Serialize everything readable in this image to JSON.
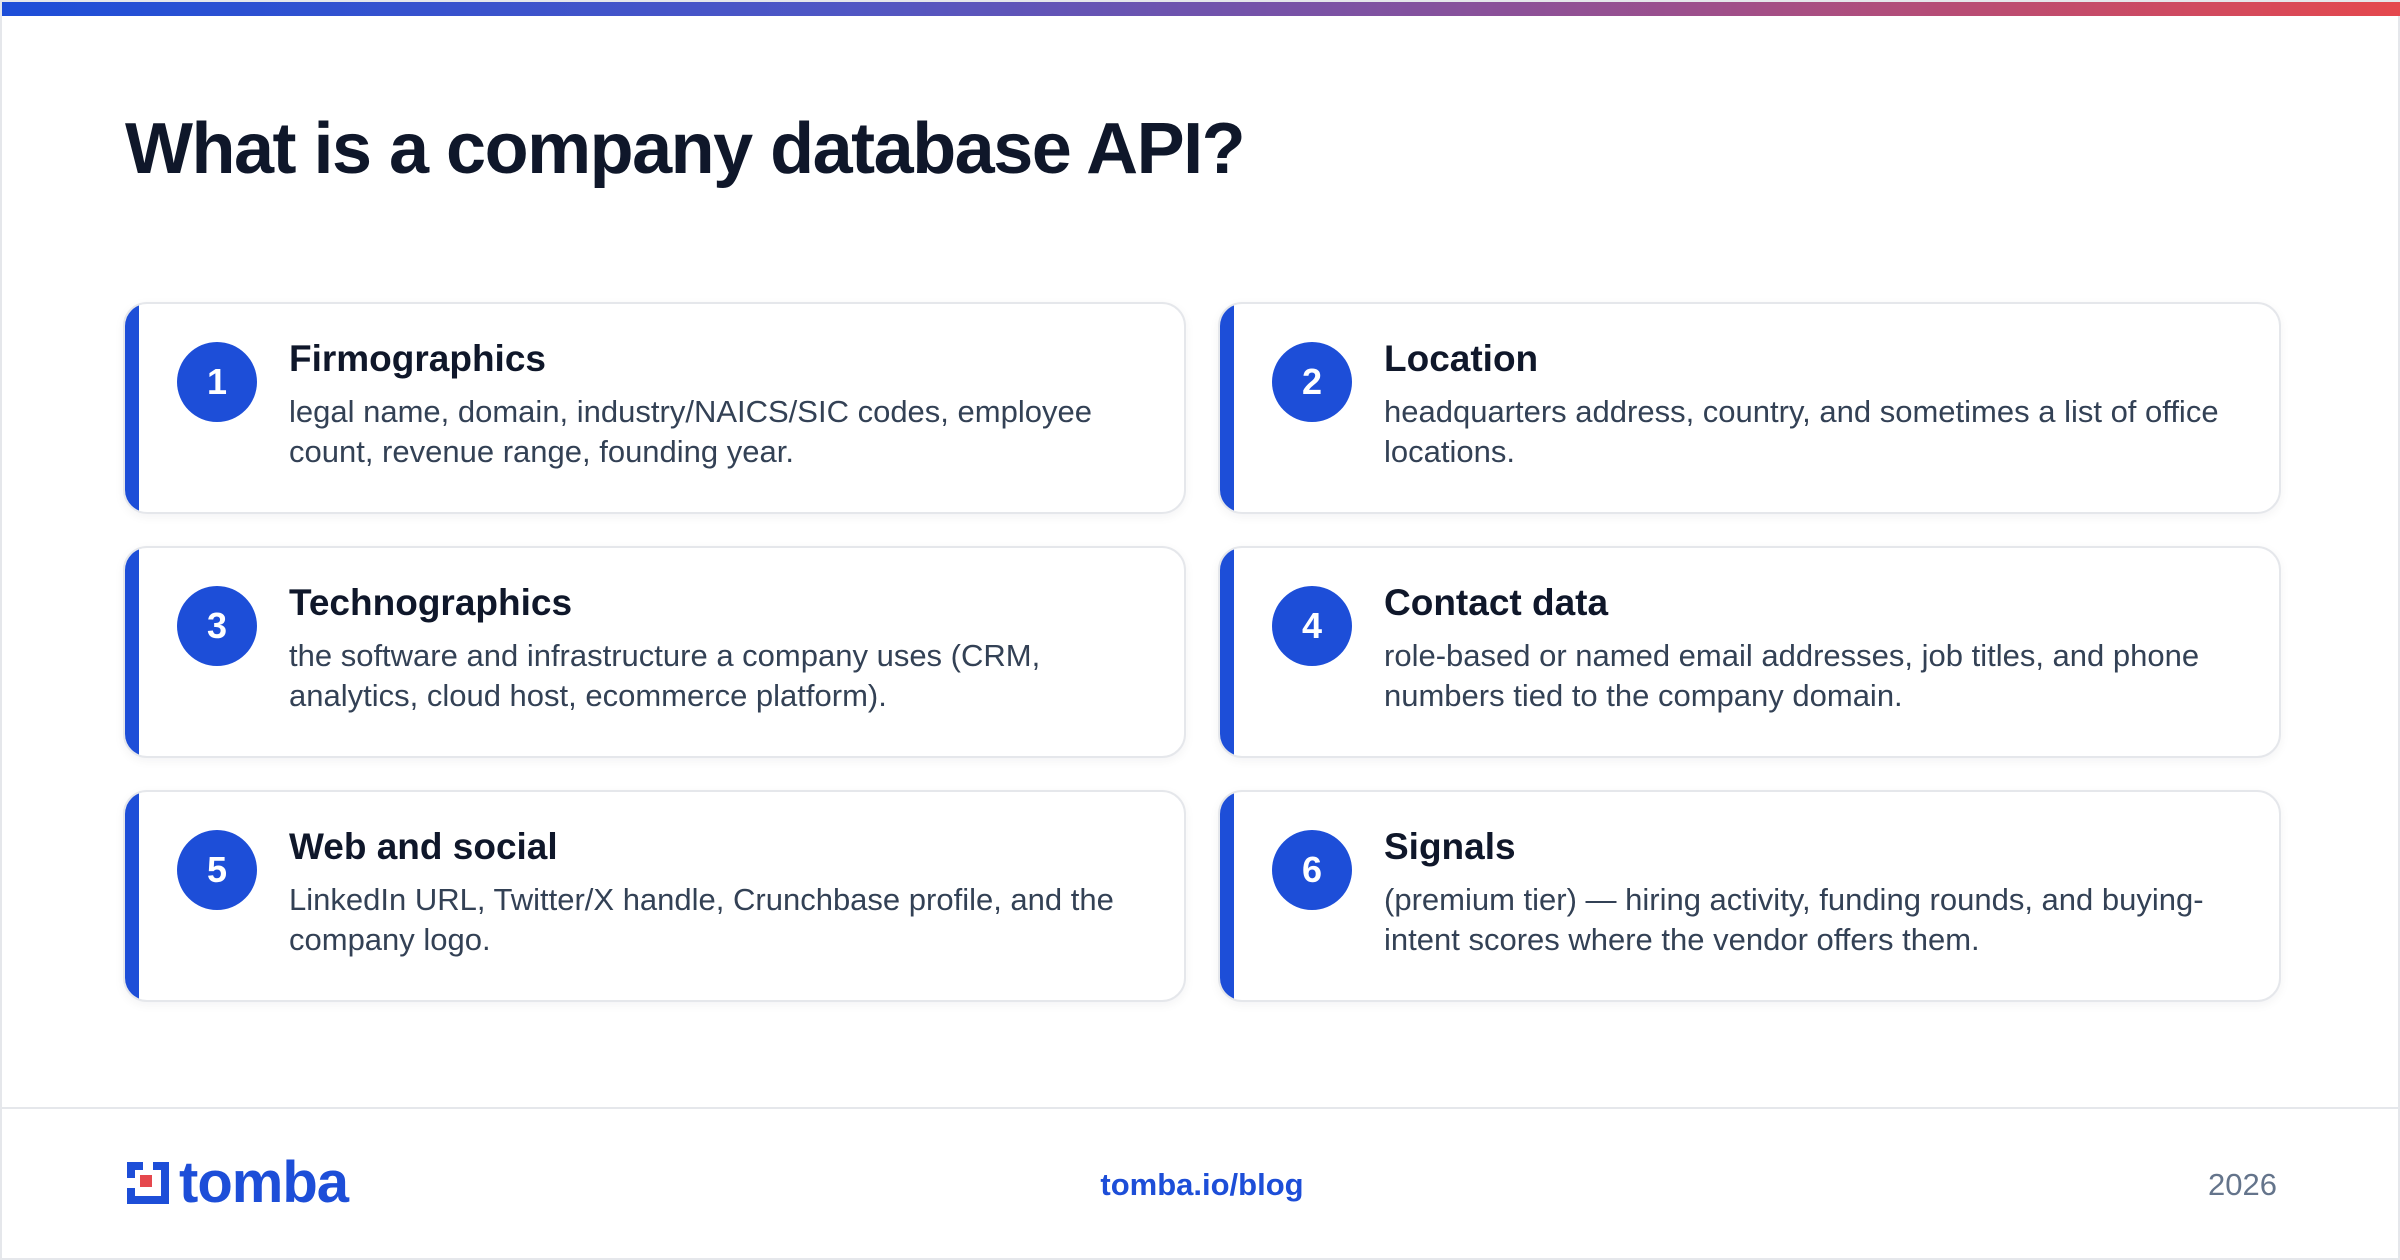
{
  "header": {
    "title": "What is a company database API?",
    "accent_colors": [
      "#1d4ed8",
      "#e5484d"
    ]
  },
  "cards": [
    {
      "number": "1",
      "title": "Firmographics",
      "description": "legal name, domain, industry/NAICS/SIC codes, employee count, revenue range, founding year."
    },
    {
      "number": "2",
      "title": "Location",
      "description": "headquarters address, country, and sometimes a list of office locations."
    },
    {
      "number": "3",
      "title": "Technographics",
      "description": "the software and infrastructure a company uses (CRM, analytics, cloud host, ecommerce platform)."
    },
    {
      "number": "4",
      "title": "Contact data",
      "description": "role-based or named email addresses, job titles, and phone numbers tied to the company domain."
    },
    {
      "number": "5",
      "title": "Web and social",
      "description": "LinkedIn URL, Twitter/X handle, Crunchbase profile, and the company logo."
    },
    {
      "number": "6",
      "title": "Signals",
      "description": "(premium tier) — hiring activity, funding rounds, and buying-intent scores where the vendor offers them."
    }
  ],
  "footer": {
    "logo_text": "tomba",
    "logo_icon": "tomba-logo-icon",
    "link": "tomba.io/blog",
    "year": "2026"
  },
  "colors": {
    "brand_blue": "#1d4ed8",
    "brand_red": "#e5484d",
    "text_dark": "#0f172a",
    "text_body": "#334155",
    "text_muted": "#64748b"
  }
}
